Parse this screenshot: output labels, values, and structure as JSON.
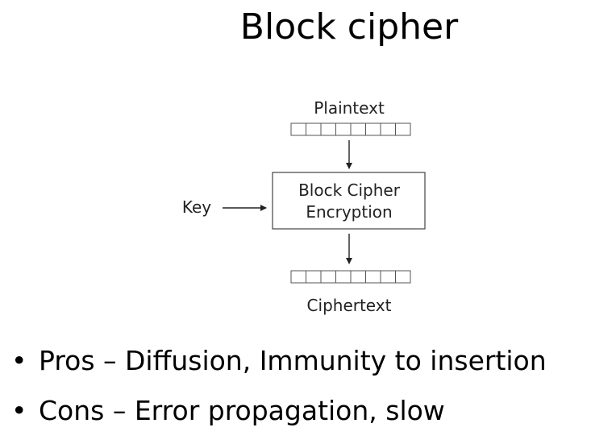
{
  "slide": {
    "title": "Block cipher"
  },
  "diagram": {
    "plaintext_label": "Plaintext",
    "key_label": "Key",
    "cipher_box_line1": "Block Cipher",
    "cipher_box_line2": "Encryption",
    "ciphertext_label": "Ciphertext",
    "block_cells": 8
  },
  "bullets": [
    {
      "marker": "•",
      "text": "Pros – Diffusion, Immunity to insertion"
    },
    {
      "marker": "•",
      "text": "Cons – Error propagation, slow"
    }
  ]
}
